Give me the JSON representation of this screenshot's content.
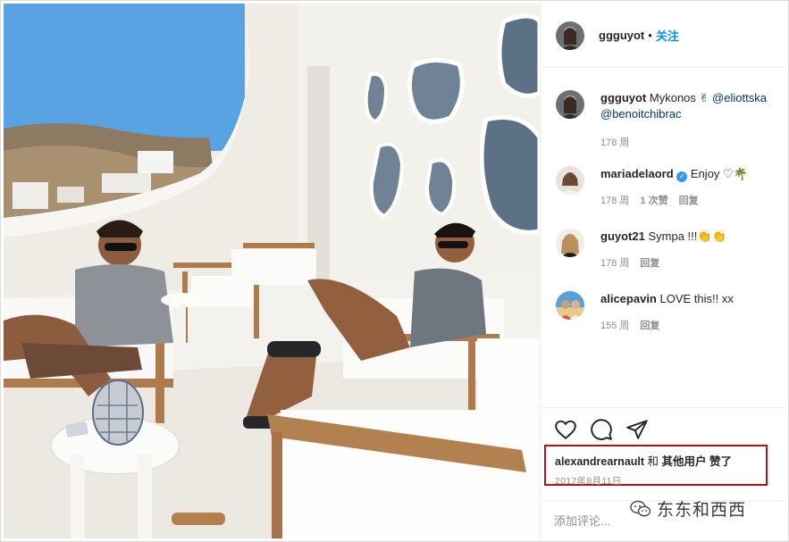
{
  "post": {
    "author": "ggguyot",
    "follow_label": "关注",
    "dot": "•"
  },
  "comments": [
    {
      "user": "ggguyot",
      "text": "Mykonos ✌",
      "mentions": [
        "@eliottska",
        "@benoitchibrac"
      ],
      "time": "178 周",
      "likes": "",
      "reply": ""
    },
    {
      "user": "mariadelaord",
      "verified": true,
      "text": "Enjoy ♡🌴",
      "time": "178 周",
      "likes": "1 次赞",
      "reply": "回复"
    },
    {
      "user": "guyot21",
      "text": "Sympa !!!👏👏",
      "time": "178 周",
      "likes": "",
      "reply": "回复"
    },
    {
      "user": "alicepavin",
      "text": "LOVE this!! xx",
      "time": "155 周",
      "likes": "",
      "reply": "回复"
    }
  ],
  "actions": {
    "like_icon": "heart-icon",
    "comment_icon": "comment-icon",
    "share_icon": "paper-plane-icon"
  },
  "likes_summary": {
    "user": "alexandrearnault",
    "and": "和",
    "others": "其他用户",
    "suffix": "赞了"
  },
  "date": "2017年8月11日",
  "add_comment_placeholder": "添加评论...",
  "watermark": {
    "text": "东东和西西",
    "icon": "wechat-icon"
  },
  "colors": {
    "accent": "#0095f6",
    "highlight_border": "#b3131a",
    "muted": "#8e8e8e"
  }
}
